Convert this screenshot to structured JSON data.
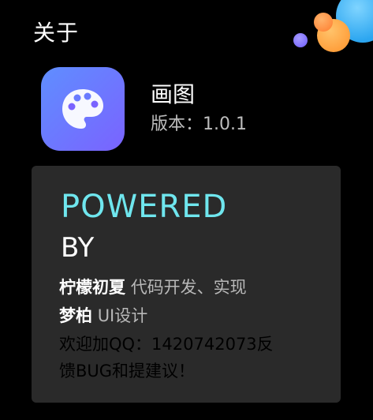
{
  "header": {
    "title": "关于"
  },
  "app": {
    "icon": "palette-icon",
    "name": "画图",
    "version_label": "版本：1.0.1"
  },
  "credits": {
    "powered": "POWERED",
    "by": "BY",
    "developer_name": "柠檬初夏",
    "developer_role": "代码开发、实现",
    "designer_name": "梦柏",
    "designer_role": "UI设计",
    "contact_line": "欢迎加QQ：1420742073反",
    "contact_line_2": "馈BUG和提建议！"
  },
  "colors": {
    "background": "#000000",
    "card": "#2a2a2a",
    "powered_text": "#6fe6ee",
    "icon_gradient_start": "#5f8eff",
    "icon_gradient_end": "#7a63ff",
    "decor_blue": "#2ca6f0",
    "decor_orange": "#ff9e3a",
    "decor_purple": "#7b6cff"
  }
}
